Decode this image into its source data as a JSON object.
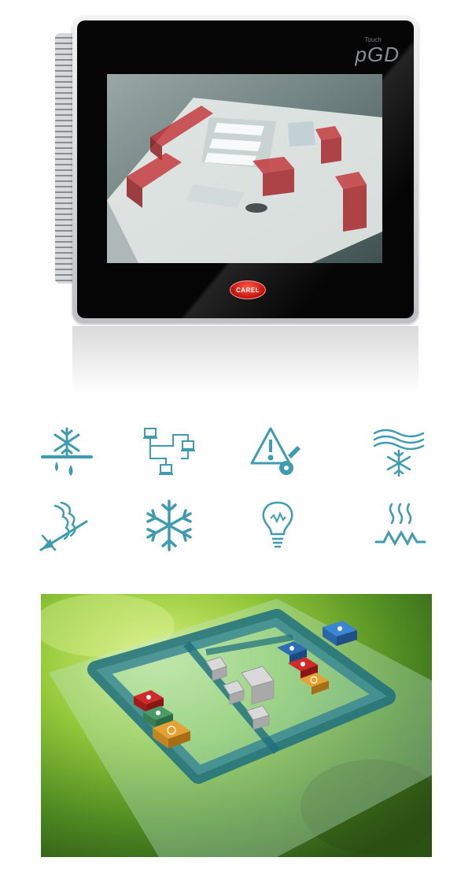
{
  "device": {
    "brand_badge": "CAREL",
    "model_logo": "pGD",
    "model_logo_small": "Touch"
  },
  "colors": {
    "icon_blue": "#3f9cb0",
    "tile_red": "#c21f1f",
    "tile_green": "#4c9a6a",
    "tile_orange": "#e39a2c",
    "tile_blue": "#2c6db5"
  },
  "icons": [
    {
      "name": "defrost-icon"
    },
    {
      "name": "network-icon"
    },
    {
      "name": "alarm-maintenance-icon"
    },
    {
      "name": "air-cooling-icon"
    },
    {
      "name": "compressor-icon"
    },
    {
      "name": "snowflake-icon"
    },
    {
      "name": "lightbulb-icon"
    },
    {
      "name": "heating-icon"
    }
  ]
}
